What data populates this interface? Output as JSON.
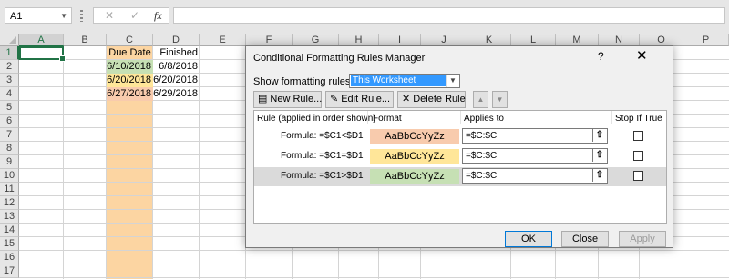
{
  "formula_bar": {
    "name_box": "A1",
    "cancel_glyph": "✕",
    "enter_glyph": "✓",
    "fx_label": "fx",
    "formula": ""
  },
  "columns": [
    "A",
    "B",
    "C",
    "D",
    "E",
    "F",
    "G",
    "H",
    "I",
    "J",
    "K",
    "L",
    "M",
    "N",
    "O",
    "P"
  ],
  "rows": [
    "1",
    "2",
    "3",
    "4",
    "5",
    "6",
    "7",
    "8",
    "9",
    "10",
    "11",
    "12",
    "13",
    "14",
    "15",
    "16",
    "17"
  ],
  "cells": {
    "c1": "Due Date",
    "d1": "Finished",
    "c2": "6/10/2018",
    "d2": "6/8/2018",
    "c3": "6/20/2018",
    "d3": "6/20/2018",
    "c4": "6/27/2018",
    "d4": "6/29/2018"
  },
  "dialog": {
    "title": "Conditional Formatting Rules Manager",
    "help": "?",
    "close": "✕",
    "show_label": "Show formatting rules for:",
    "show_value": "This Worksheet",
    "buttons": {
      "new_rule": "New Rule...",
      "edit_rule": "Edit Rule...",
      "delete_rule": "Delete Rule",
      "move_up": "▲",
      "move_down": "▼"
    },
    "headers": {
      "rule": "Rule (applied in order shown)",
      "format": "Format",
      "applies_to": "Applies to",
      "stop_if_true": "Stop If True"
    },
    "rules": [
      {
        "rule": "Formula: =$C1<$D1",
        "preview": "AaBbCcYyZz",
        "applies_to": "=$C:$C",
        "stop_if_true": false,
        "color": "#f8cbad"
      },
      {
        "rule": "Formula: =$C1=$D1",
        "preview": "AaBbCcYyZz",
        "applies_to": "=$C:$C",
        "stop_if_true": false,
        "color": "#ffe699"
      },
      {
        "rule": "Formula: =$C1>$D1",
        "preview": "AaBbCcYyZz",
        "applies_to": "=$C:$C",
        "stop_if_true": false,
        "color": "#c6e0b4"
      }
    ],
    "ok": "OK",
    "close_button": "Close",
    "apply": "Apply"
  },
  "colors": {
    "excel_green": "#217346",
    "column_c_fill": "#fcd5a2",
    "green_fill": "#c6e0b4",
    "orange_fill": "#f8cbad",
    "yellow_fill": "#ffe699",
    "selection_blue": "#3399ff"
  }
}
